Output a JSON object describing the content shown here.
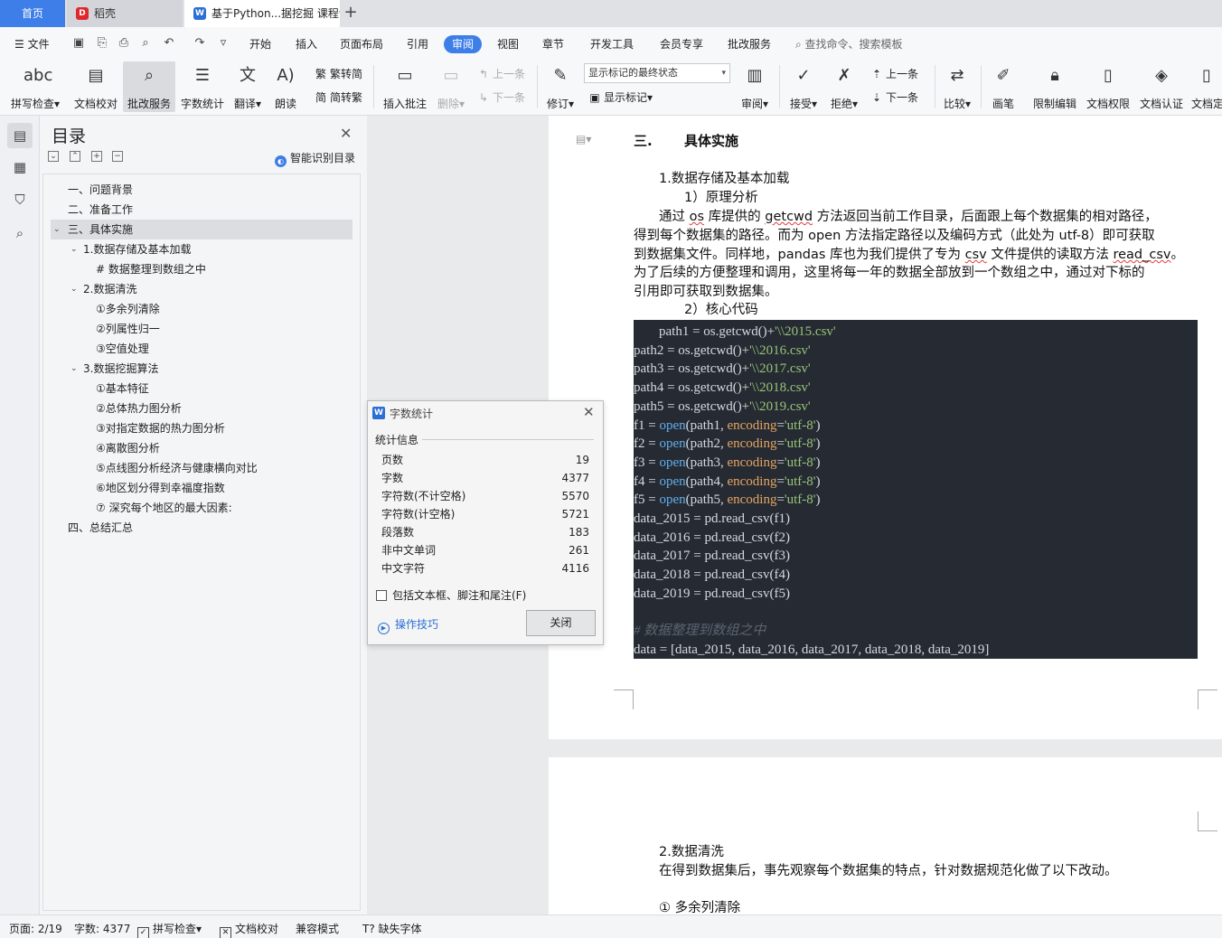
{
  "tabs": {
    "home": "首页",
    "daoke": "稻壳",
    "doc": "基于Python...据挖掘 课程论",
    "add": "+"
  },
  "menu": {
    "file": "文件",
    "items": [
      "开始",
      "插入",
      "页面布局",
      "引用",
      "审阅",
      "视图",
      "章节",
      "开发工具",
      "会员专享",
      "批改服务"
    ],
    "active": "审阅",
    "search_placeholder": "查找命令、搜索模板"
  },
  "ribbon": {
    "spell_check": "拼写检查",
    "doc_proof": "文档校对",
    "correction_service": "批改服务",
    "word_count": "字数统计",
    "translate": "翻译",
    "read_aloud": "朗读",
    "trad_to_simp": "繁转简",
    "simp_to_trad": "简转繁",
    "insert_comment": "插入批注",
    "delete": "删除",
    "prev": "上一条",
    "next": "下一条",
    "revise": "修订",
    "markup_state": "显示标记的最终状态",
    "show_markup": "显示标记",
    "review": "审阅",
    "accept": "接受",
    "reject": "拒绝",
    "prev2": "上一条",
    "next2": "下一条",
    "compare": "比较",
    "pen": "画笔",
    "restrict_edit": "限制编辑",
    "doc_permission": "文档权限",
    "doc_cert": "文档认证",
    "doc_more": "文档定"
  },
  "toc": {
    "title": "目录",
    "smart": "智能识别目录",
    "items": [
      "一、问题背景",
      "二、准备工作",
      "三、具体实施",
      "1.数据存储及基本加载",
      "# 数据整理到数组之中",
      "2.数据清洗",
      "①多余列清除",
      "②列属性归一",
      "③空值处理",
      "3.数据挖掘算法",
      "①基本特征",
      "②总体热力图分析",
      "③对指定数据的热力图分析",
      "④离散图分析",
      "⑤点线图分析经济与健康横向对比",
      "⑥地区划分得到幸福度指数",
      "⑦  深究每个地区的最大因素:",
      "四、总结汇总"
    ]
  },
  "word_count": {
    "title": "字数统计",
    "group": "统计信息",
    "rows": [
      {
        "k": "页数",
        "v": "19"
      },
      {
        "k": "字数",
        "v": "4377"
      },
      {
        "k": "字符数(不计空格)",
        "v": "5570"
      },
      {
        "k": "字符数(计空格)",
        "v": "5721"
      },
      {
        "k": "段落数",
        "v": "183"
      },
      {
        "k": "非中文单词",
        "v": "261"
      },
      {
        "k": "中文字符",
        "v": "4116"
      }
    ],
    "include_label": "包括文本框、脚注和尾注(F)",
    "tips": "操作技巧",
    "close": "关闭"
  },
  "document": {
    "heading_num": "三.",
    "heading": "具体实施",
    "sub1": "1.数据存储及基本加载",
    "sub1a": "1）原理分析",
    "para": [
      [
        "通过 ",
        "os",
        " 库提供的 ",
        "getcwd",
        " 方法返回当前工作目录，后面跟上每个数据集的相对路径，"
      ],
      "得到每个数据集的路径。而为 open 方法指定路径以及编码方式（此处为 utf-8）即可获取",
      [
        "到数据集文件。同样地，pandas 库也为我们提供了专为 ",
        "csv",
        " 文件提供的读取方法 ",
        "read_csv",
        "。"
      ],
      "为了后续的方便整理和调用，这里将每一年的数据全部放到一个数组之中，通过对下标的",
      "引用即可获取到数据集。"
    ],
    "sub1b": "2）核心代码",
    "code": {
      "path_lines": [
        {
          "var": "path1",
          "str": "'\\\\2015.csv'"
        },
        {
          "var": "path2",
          "str": "'\\\\2016.csv'"
        },
        {
          "var": "path3",
          "str": "'\\\\2017.csv'"
        },
        {
          "var": "path4",
          "str": "'\\\\2018.csv'"
        },
        {
          "var": "path5",
          "str": "'\\\\2019.csv'"
        }
      ],
      "path_mid": " = os.getcwd()+",
      "open_lines": [
        {
          "var": "f1",
          "arg": "path1"
        },
        {
          "var": "f2",
          "arg": "path2"
        },
        {
          "var": "f3",
          "arg": "path3"
        },
        {
          "var": "f4",
          "arg": "path4"
        },
        {
          "var": "f5",
          "arg": "path5"
        }
      ],
      "open_fn": "open",
      "encoding_kw": "encoding",
      "encoding_val": "'utf-8'",
      "read_lines": [
        {
          "var": "data_2015",
          "arg": "f1"
        },
        {
          "var": "data_2016",
          "arg": "f2"
        },
        {
          "var": "data_2017",
          "arg": "f3"
        },
        {
          "var": "data_2018",
          "arg": "f4"
        },
        {
          "var": "data_2019",
          "arg": "f5"
        }
      ],
      "read_fn": "pd.read_csv",
      "comment": "# 数据整理到数组之中",
      "final": "data = [data_2015, data_2016, data_2017, data_2018, data_2019]"
    },
    "sub2": "2.数据清洗",
    "sub2_para": "在得到数据集后，事先观察每个数据集的特点，针对数据规范化做了以下改动。",
    "sub2_item": "① 多余列清除"
  },
  "status": {
    "page": "页面: 2/19",
    "words": "字数: 4377",
    "spell": "拼写检查",
    "proof": "文档校对",
    "compat": "兼容模式",
    "missing_font": "缺失字体"
  }
}
